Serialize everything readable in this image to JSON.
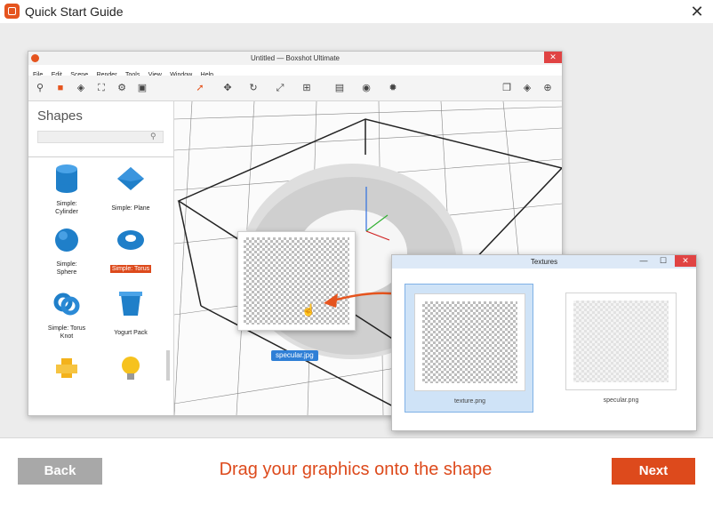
{
  "window": {
    "title": "Quick Start Guide",
    "close_glyph": "✕"
  },
  "boxshot": {
    "title": "Untitled — Boxshot Ultimate",
    "close_glyph": "✕",
    "menu": [
      "File",
      "Edit",
      "Scene",
      "Render",
      "Tools",
      "View",
      "Window",
      "Help"
    ],
    "sidebar": {
      "title": "Shapes",
      "search_placeholder": "",
      "items": [
        {
          "label": "Simple:",
          "label2": "Cylinder",
          "icon": "cylinder-icon",
          "selected": false
        },
        {
          "label": "Simple: Plane",
          "label2": "",
          "icon": "plane-icon",
          "selected": false
        },
        {
          "label": "Simple:",
          "label2": "Sphere",
          "icon": "sphere-icon",
          "selected": false
        },
        {
          "label": "Simple: Torus",
          "label2": "",
          "icon": "torus-icon",
          "selected": true
        },
        {
          "label": "Simple: Torus",
          "label2": "Knot",
          "icon": "torus-knot-icon",
          "selected": false
        },
        {
          "label": "Yogurt Pack",
          "label2": "",
          "icon": "yogurt-pack-icon",
          "selected": false
        }
      ]
    },
    "drag_label": "specular.jpg"
  },
  "textures_window": {
    "title": "Textures",
    "close_glyph": "✕",
    "minimize_glyph": "—",
    "maximize_glyph": "☐",
    "items": [
      {
        "label": "texture.png",
        "selected": true
      },
      {
        "label": "specular.png",
        "selected": false
      }
    ]
  },
  "footer": {
    "back_label": "Back",
    "caption": "Drag your graphics onto the shape",
    "next_label": "Next"
  },
  "colors": {
    "accent": "#dd4a1c",
    "selection": "#2f7fd6",
    "back_button": "#a8a8a8"
  }
}
